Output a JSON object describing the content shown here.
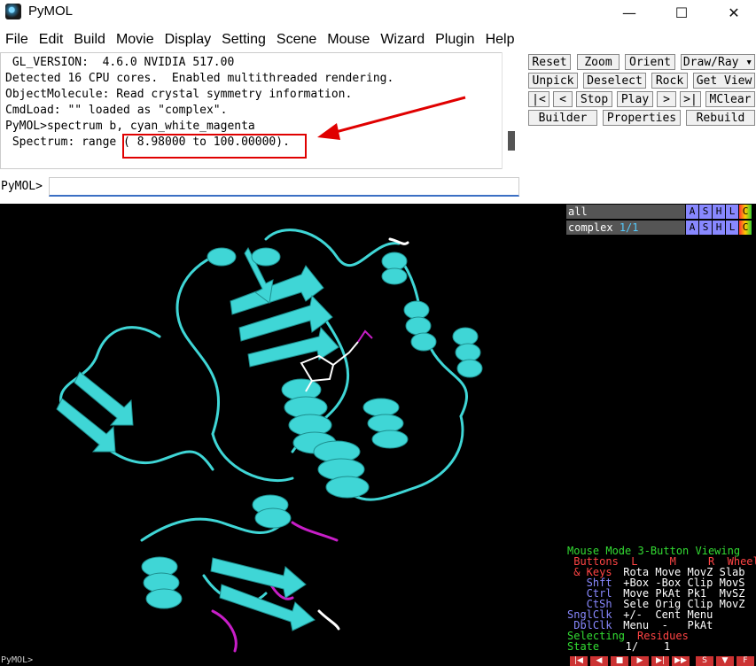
{
  "window": {
    "title": "PyMOL",
    "minimize_glyph": "—",
    "maximize_glyph": "☐",
    "close_glyph": "✕"
  },
  "menu": [
    "File",
    "Edit",
    "Build",
    "Movie",
    "Display",
    "Setting",
    "Scene",
    "Mouse",
    "Wizard",
    "Plugin",
    "Help"
  ],
  "output": {
    "lines": [
      " GL_VERSION:  4.6.0 NVIDIA 517.00",
      "Detected 16 CPU cores.  Enabled multithreaded rendering.",
      "ObjectMolecule: Read crystal symmetry information.",
      "CmdLoad: \"\" loaded as \"complex\".",
      "PyMOL>spectrum b, cyan_white_magenta",
      " Spectrum: range ( 8.98000 to 100.00000)."
    ]
  },
  "command": {
    "prompt": "PyMOL>",
    "value": ""
  },
  "buttons": {
    "row1": [
      "Reset",
      "Zoom",
      "Orient",
      "Draw/Ray ▾"
    ],
    "row2": [
      "Unpick",
      "Deselect",
      "Rock",
      "Get View"
    ],
    "row3": [
      "|<",
      "<",
      "Stop",
      "Play",
      ">",
      ">|",
      "MClear"
    ],
    "row4": [
      "Builder",
      "Properties",
      "Rebuild"
    ]
  },
  "objects": [
    {
      "name": "all",
      "state": "",
      "buttons": [
        "A",
        "S",
        "H",
        "L",
        "C"
      ]
    },
    {
      "name": "complex",
      "state": "1/1",
      "buttons": [
        "A",
        "S",
        "H",
        "L",
        "C"
      ]
    }
  ],
  "mouse_mode": {
    "title": "Mouse Mode 3-Button Viewing",
    "header": " Buttons  L     M     R  Wheel",
    "rows": [
      {
        "key": " & Keys",
        "vals": " Rota Move MovZ Slab"
      },
      {
        "key": "   Shft",
        "vals": " +Box -Box Clip MovS"
      },
      {
        "key": "   Ctrl",
        "vals": " Move PkAt Pk1  MvSZ"
      },
      {
        "key": "   CtSh",
        "vals": " Sele Orig Clip MovZ"
      },
      {
        "key": "SnglClk",
        "vals": " +/-  Cent Menu"
      },
      {
        "key": " DblClk",
        "vals": " Menu  -   PkAt"
      }
    ],
    "selecting_label": "Selecting",
    "selecting_value": "Residues",
    "state_label": "State",
    "state_value": "   1/    1"
  },
  "playback": [
    "|◀",
    "◀",
    "■",
    "▶",
    "▶|",
    "▶▶",
    "S",
    "▼",
    "F"
  ],
  "bottom_prompt": "PyMOL>",
  "colors": {
    "protein": "#3fd6d6",
    "highlight": "#e00000",
    "magenta": "#c81ec8",
    "mouse_green": "#33dd33",
    "mouse_red": "#ff4444",
    "mouse_blue": "#8888ff"
  }
}
